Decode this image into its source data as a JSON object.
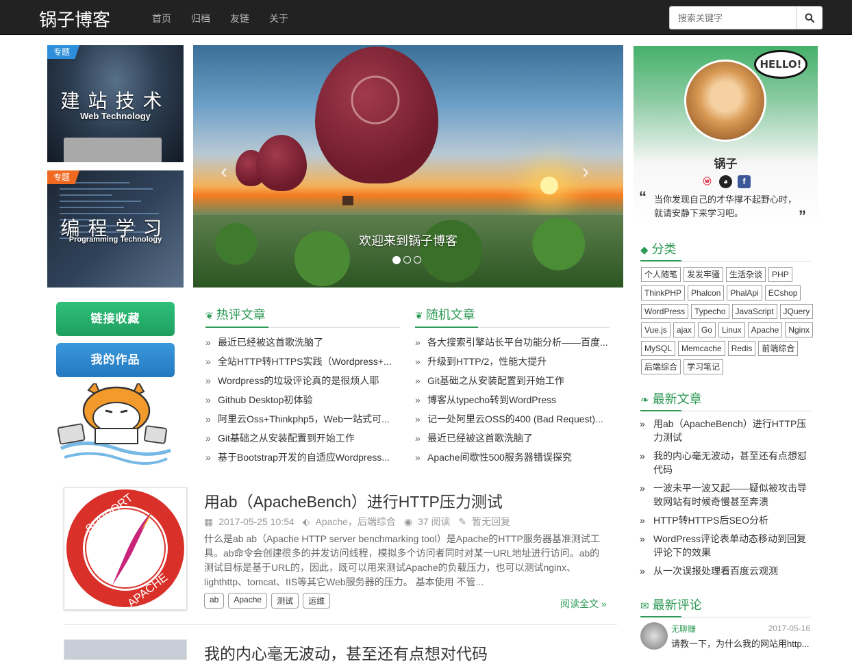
{
  "navbar": {
    "brand": "锅子博客",
    "links": [
      "首页",
      "归档",
      "友链",
      "关于"
    ],
    "search_placeholder": "搜索关键字"
  },
  "topics": [
    {
      "badge": "专题",
      "title": "建站技术",
      "subtitle": "Web Technology"
    },
    {
      "badge": "专题",
      "title": "编程学习",
      "subtitle": "Programming Technology"
    }
  ],
  "carousel": {
    "caption": "欢迎来到锅子博客",
    "prev": "‹",
    "next": "›"
  },
  "left_buttons": {
    "links": "链接收藏",
    "works": "我的作品"
  },
  "hot": {
    "title": "热评文章",
    "items": [
      "最近已经被这首歌洗脑了",
      "全站HTTP转HTTPS实践（Wordpress+...",
      "Wordpress的垃圾评论真的是很烦人耶",
      "Github Desktop初体验",
      "阿里云Oss+Thinkphp5，Web一站式可...",
      "Git基础之从安装配置到开始工作",
      "基于Bootstrap开发的自适应Wordpress..."
    ]
  },
  "random": {
    "title": "随机文章",
    "items": [
      "各大搜索引擎站长平台功能分析——百度...",
      "升级到HTTP/2，性能大提升",
      "Git基础之从安装配置到开始工作",
      "博客从typecho转到WordPress",
      "记一处阿里云OSS的400 (Bad Request)...",
      "最近已经被这首歌洗脑了",
      "Apache间歇性500服务器错误探究"
    ]
  },
  "article": {
    "title": "用ab（ApacheBench）进行HTTP压力测试",
    "date": "2017-05-25 10:54",
    "category": "Apache，后端综合",
    "views": "37 阅读",
    "comments": "暂无回复",
    "excerpt": "什么是ab ab（Apache HTTP server benchmarking tool）是Apache的HTTP服务器基准测试工具。ab命令会创建很多的并发访问线程，模拟多个访问者同时对某一URL地址进行访问。ab的测试目标是基于URL的，因此，既可以用来测试Apache的负载压力，也可以测试nginx、lighthttp、tomcat、IIS等其它Web服务器的压力。 基本使用 不管...",
    "tags": [
      "ab",
      "Apache",
      "测试",
      "运维"
    ],
    "read_more": "阅读全文 »",
    "image_text_top": "SUPPORT",
    "image_text_bottom": "APACHE"
  },
  "article2": {
    "title": "我的内心毫无波动，甚至还有点想对代码"
  },
  "profile": {
    "hello": "HELLO!",
    "name": "锅子",
    "quote": "当你发现自己的才华撑不起野心时，就请安静下来学习吧。"
  },
  "categories": {
    "title": "分类",
    "items": [
      "个人随笔",
      "发发牢骚",
      "生活杂谈",
      "PHP",
      "ThinkPHP",
      "Phalcon",
      "PhalApi",
      "ECshop",
      "WordPress",
      "Typecho",
      "JavaScript",
      "JQuery",
      "Vue.js",
      "ajax",
      "Go",
      "Linux",
      "Apache",
      "Nginx",
      "MySQL",
      "Memcache",
      "Redis",
      "前端综合",
      "后端综合",
      "学习笔记"
    ]
  },
  "latest": {
    "title": "最新文章",
    "items": [
      "用ab（ApacheBench）进行HTTP压力测试",
      "我的内心毫无波动，甚至还有点想怼代码",
      "一波未平一波又起——疑似被攻击导致网站有时候奇慢甚至奔溃",
      "HTTP转HTTPS后SEO分析",
      "WordPress评论表单动态移动到回复评论下的效果",
      "从一次误报处理看百度云观测"
    ]
  },
  "recent_comments": {
    "title": "最新评论",
    "name": "无聊赚",
    "date": "2017-05-16",
    "text": "请教一下，为什么我的网站用http..."
  },
  "colors": {
    "accent": "#2d9a55",
    "navbar": "#222222",
    "blue_button": "#2479bf",
    "green_button": "#1f9f5f"
  }
}
